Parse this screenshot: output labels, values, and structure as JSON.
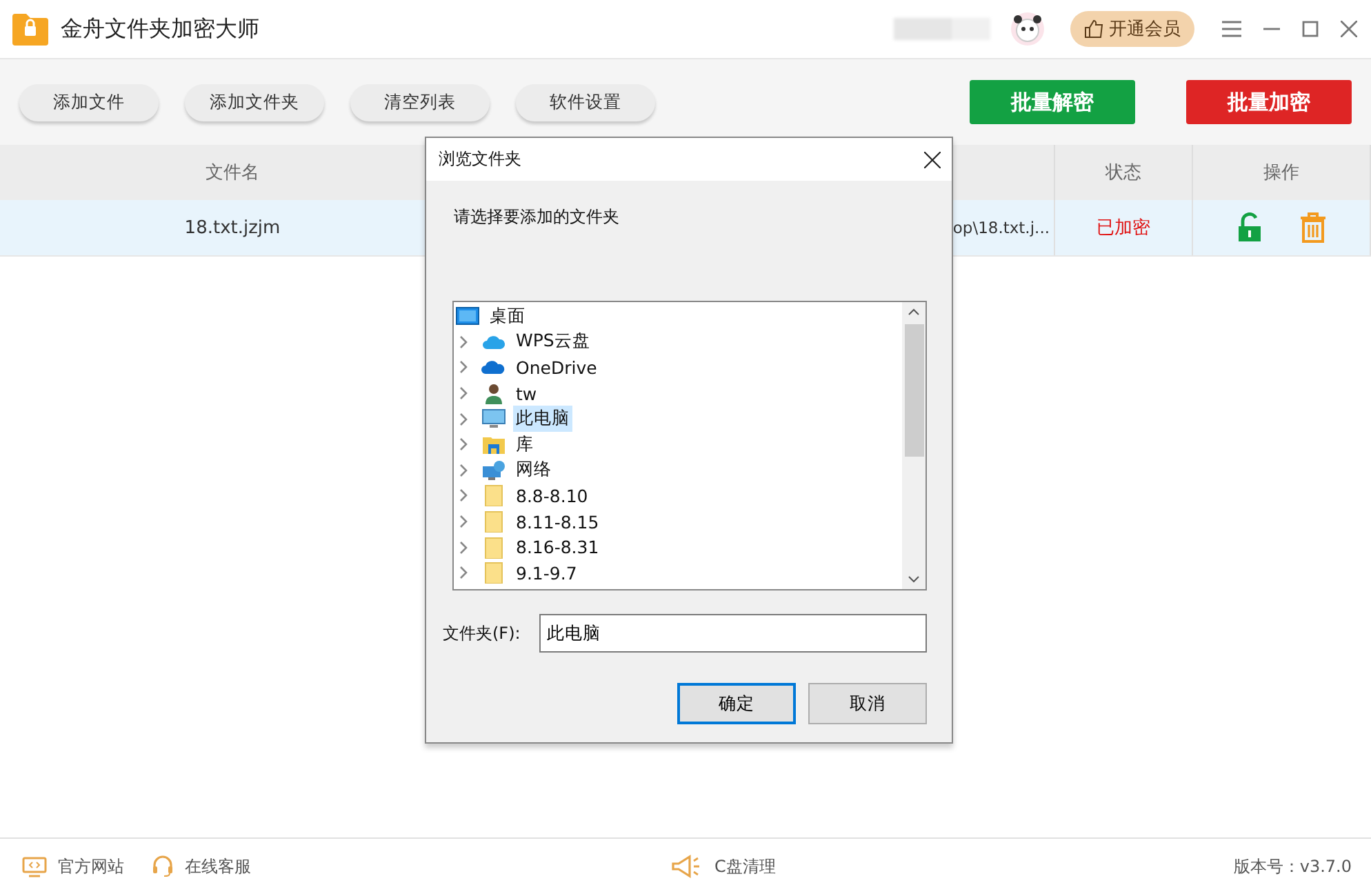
{
  "window": {
    "title": "金舟文件夹加密大师",
    "vip_button": "开通会员"
  },
  "toolbar": {
    "buttons": [
      {
        "label": "添加文件"
      },
      {
        "label": "添加文件夹"
      },
      {
        "label": "清空列表"
      },
      {
        "label": "软件设置"
      }
    ],
    "actions": [
      {
        "label": "批量解密",
        "kind": "decrypt"
      },
      {
        "label": "批量加密",
        "kind": "encrypt"
      }
    ]
  },
  "table": {
    "columns": [
      "文件名",
      "",
      "状态",
      "操作"
    ],
    "rows": [
      {
        "name": "18.txt.jzjm",
        "column_2": "op\\18.txt.j...",
        "status": "已加密",
        "selected": true
      }
    ]
  },
  "dialog": {
    "title": "浏览文件夹",
    "prompt": "请选择要添加的文件夹",
    "tree": [
      {
        "label": "桌面",
        "kind": "desktop",
        "selected": false,
        "children": [
          {
            "label": "WPS云盘",
            "kind": "cloud",
            "selected": false
          },
          {
            "label": "OneDrive",
            "kind": "onedrive",
            "selected": false
          },
          {
            "label": "tw",
            "kind": "user",
            "selected": false
          },
          {
            "label": "此电脑",
            "kind": "computer",
            "selected": true
          },
          {
            "label": "库",
            "kind": "library",
            "selected": false
          },
          {
            "label": "网络",
            "kind": "network",
            "selected": false
          },
          {
            "label": "8.8-8.10",
            "kind": "folder",
            "selected": false
          },
          {
            "label": "8.11-8.15",
            "kind": "folder",
            "selected": false
          },
          {
            "label": "8.16-8.31",
            "kind": "folder",
            "selected": false
          },
          {
            "label": "9.1-9.7",
            "kind": "folder",
            "selected": false
          }
        ]
      }
    ],
    "folder_label": "文件夹(F):",
    "folder_value": "此电脑",
    "ok": "确定",
    "cancel": "取消"
  },
  "status_bar": {
    "links": [
      {
        "label": "官方网站",
        "kind": "website"
      },
      {
        "label": "在线客服",
        "kind": "support"
      }
    ],
    "cleanup": "C盘清理",
    "version": "版本号：v3.7.0"
  }
}
